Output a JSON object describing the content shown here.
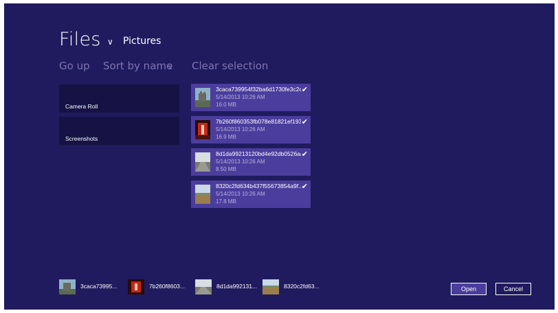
{
  "header": {
    "title": "Files",
    "title_chevron": "∨",
    "location": "Pictures"
  },
  "commands": {
    "go_up": "Go up",
    "sort_by": "Sort by name",
    "sort_chevron": "∨",
    "clear_selection": "Clear selection"
  },
  "folders": [
    {
      "label": "Camera Roll"
    },
    {
      "label": "Screenshots"
    }
  ],
  "files": [
    {
      "name": "3caca739954f32ba6d1730fe3c2c...",
      "date": "5/14/2013 10:26 AM",
      "size": "16.0 MB",
      "selected": "✔",
      "thumb": "castle"
    },
    {
      "name": "7b260f860353fb078e81821ef193...",
      "date": "5/14/2013 10:26 AM",
      "size": "16.9 MB",
      "selected": "✔",
      "thumb": "red"
    },
    {
      "name": "8d1da99213120bd4e92db0526aa...",
      "date": "5/14/2013 10:26 AM",
      "size": "8.50 MB",
      "selected": "✔",
      "thumb": "road"
    },
    {
      "name": "8320c2fd634b437f55673854a9f...",
      "date": "5/14/2013 10:26 AM",
      "size": "17.8 MB",
      "selected": "✔",
      "thumb": "field"
    }
  ],
  "basket": [
    {
      "label": "3caca73995...",
      "thumb": "castle"
    },
    {
      "label": "7b260f8603...",
      "thumb": "red"
    },
    {
      "label": "8d1da992131...",
      "thumb": "road"
    },
    {
      "label": "8320c2fd63...",
      "thumb": "field"
    }
  ],
  "buttons": {
    "open": "Open",
    "cancel": "Cancel"
  },
  "colors": {
    "background": "#201b5e",
    "folder_tile": "#161244",
    "selected_file": "#4b3d9c",
    "command_text": "#7c75b3"
  }
}
